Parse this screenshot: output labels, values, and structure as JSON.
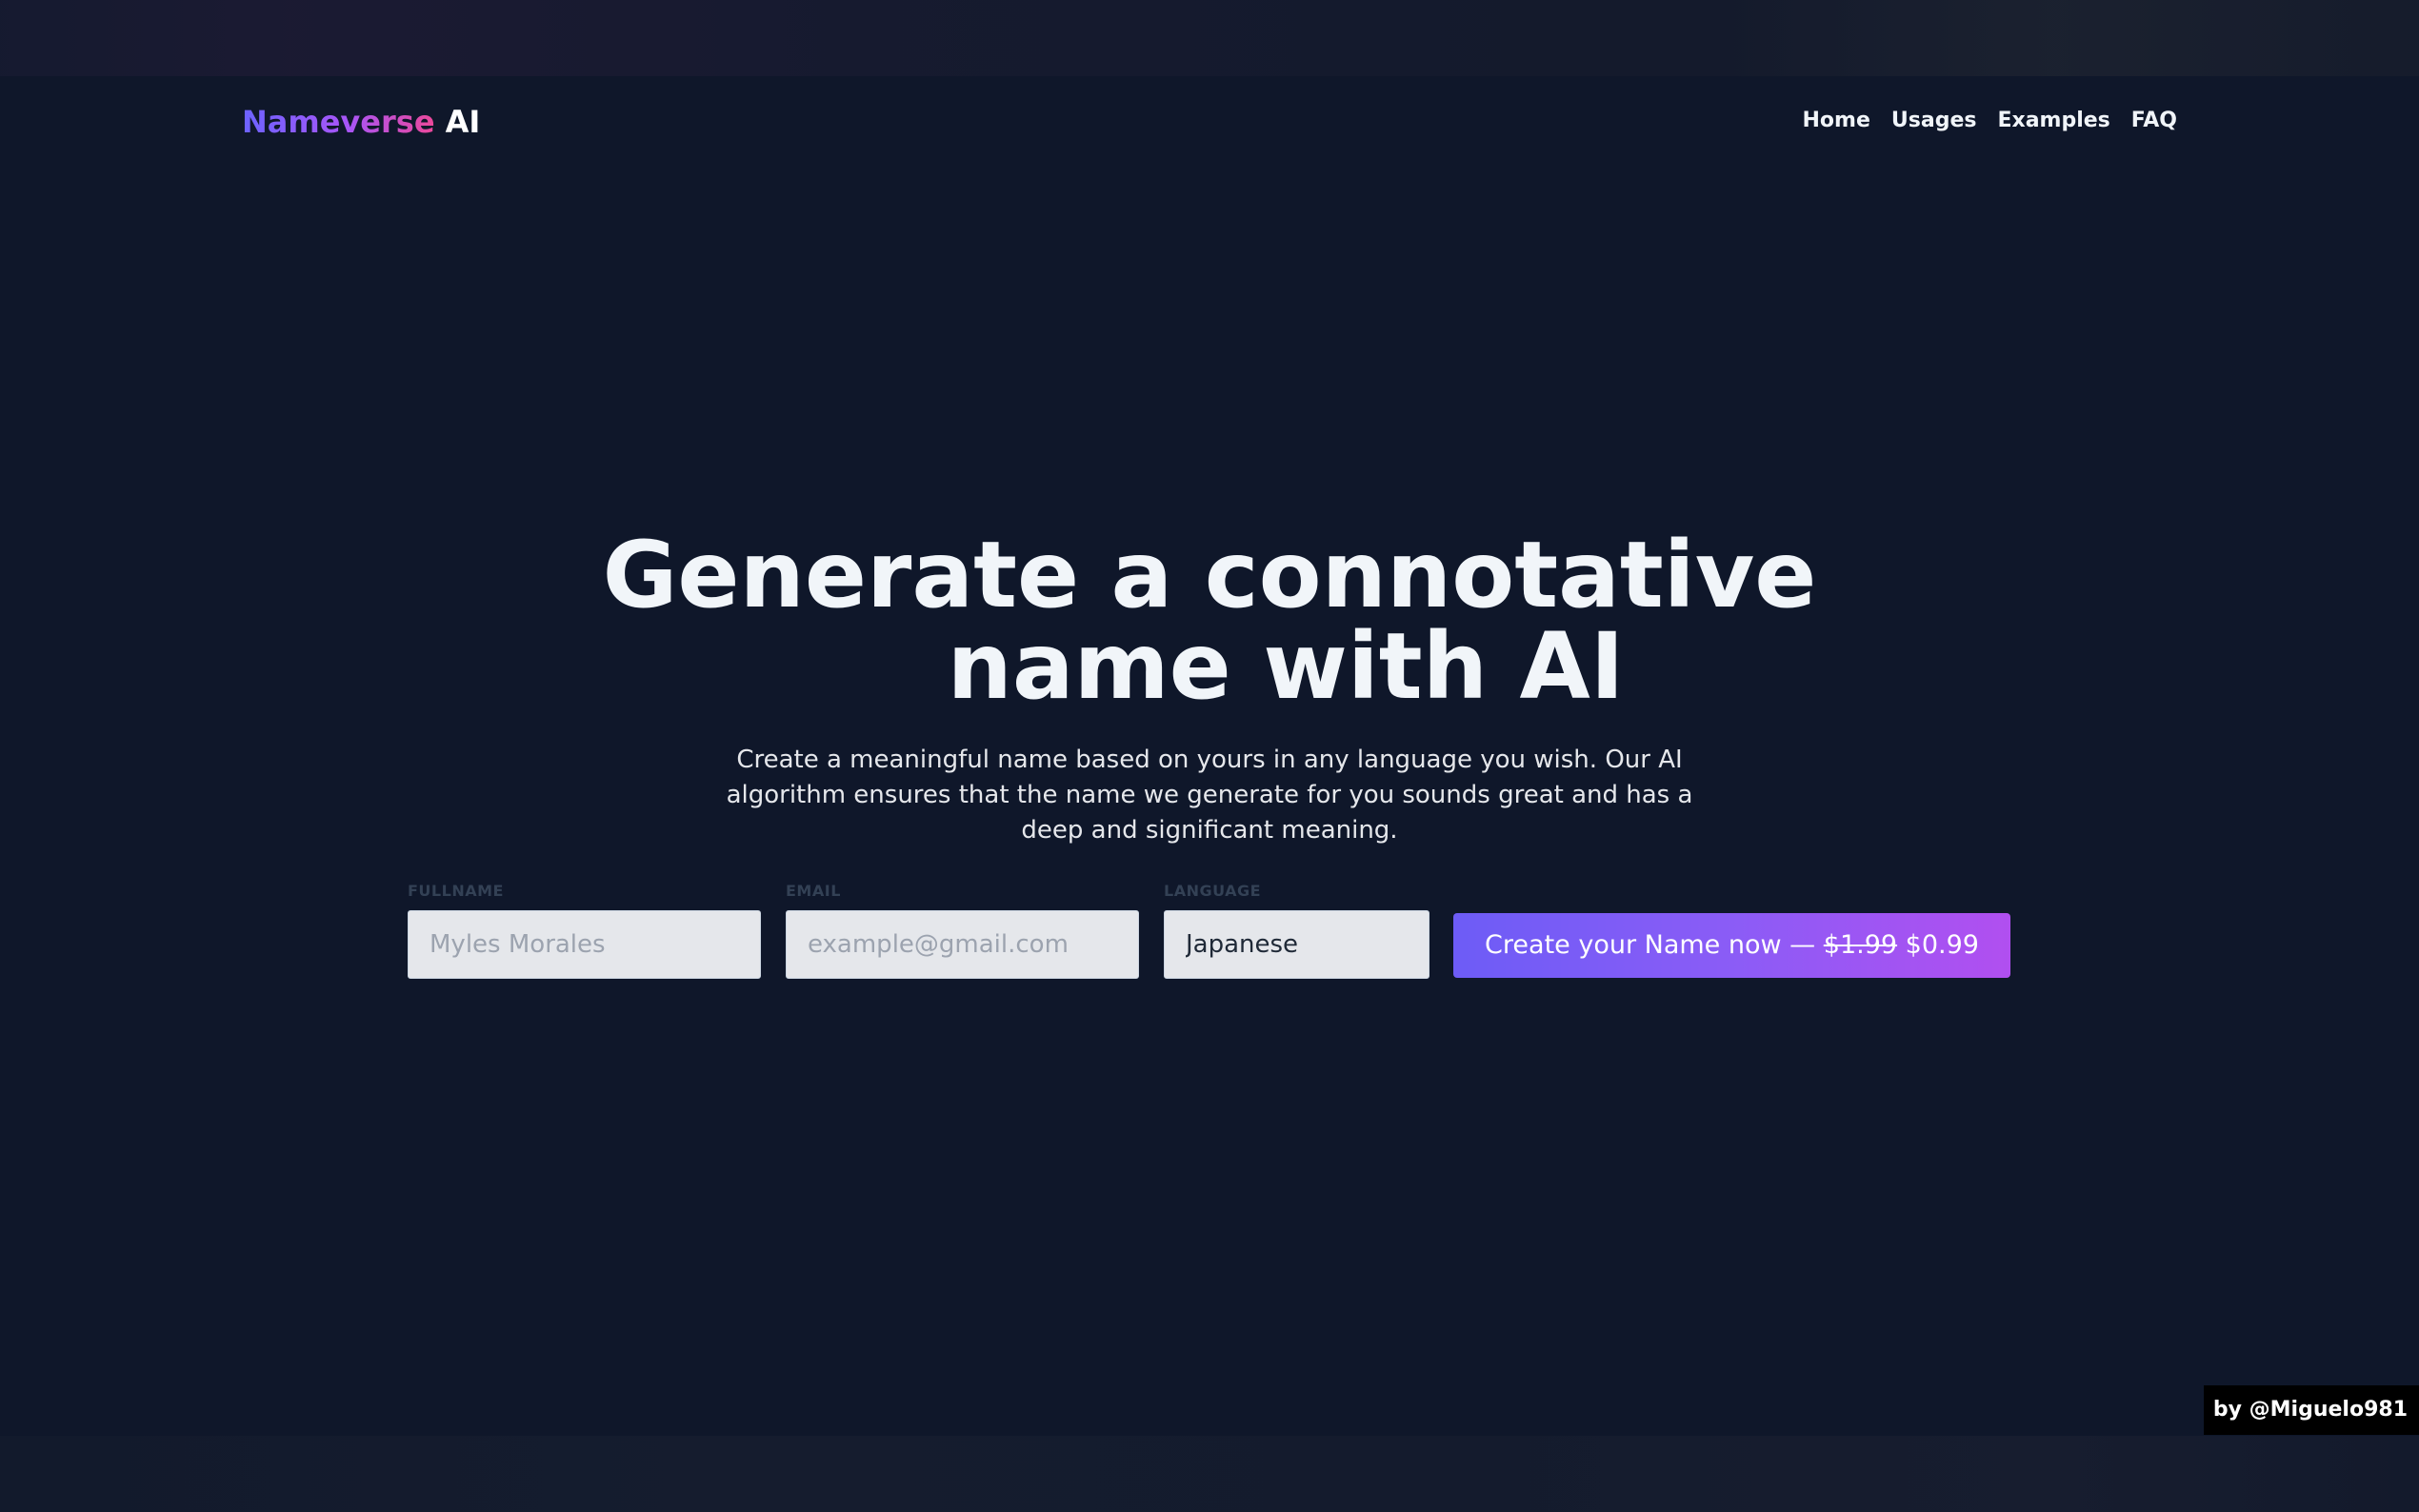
{
  "brand": {
    "name_part1": "Nameverse",
    "name_part2": "AI"
  },
  "nav": {
    "items": [
      "Home",
      "Usages",
      "Examples",
      "FAQ"
    ]
  },
  "hero": {
    "title_line1": "Generate a connotative",
    "title_line2": "name with AI",
    "subtitle": "Create a meaningful name based on yours in any language you wish. Our AI algorithm ensures that the name we generate for you sounds great and has a deep and significant meaning."
  },
  "form": {
    "fullname": {
      "label": "FULLNAME",
      "placeholder": "Myles Morales",
      "value": ""
    },
    "email": {
      "label": "EMAIL",
      "placeholder": "example@gmail.com",
      "value": ""
    },
    "language": {
      "label": "LANGUAGE",
      "value": "Japanese"
    },
    "submit": {
      "label": "Create your Name now —",
      "old_price": "$1.99",
      "new_price": "$0.99"
    }
  },
  "credit": "by @Miguelo981",
  "colors": {
    "background": "#0f172a",
    "accent_start": "#6c63ff",
    "accent_end": "#ec4899",
    "button_start": "#6d5cf6",
    "button_end": "#b14ff0"
  }
}
